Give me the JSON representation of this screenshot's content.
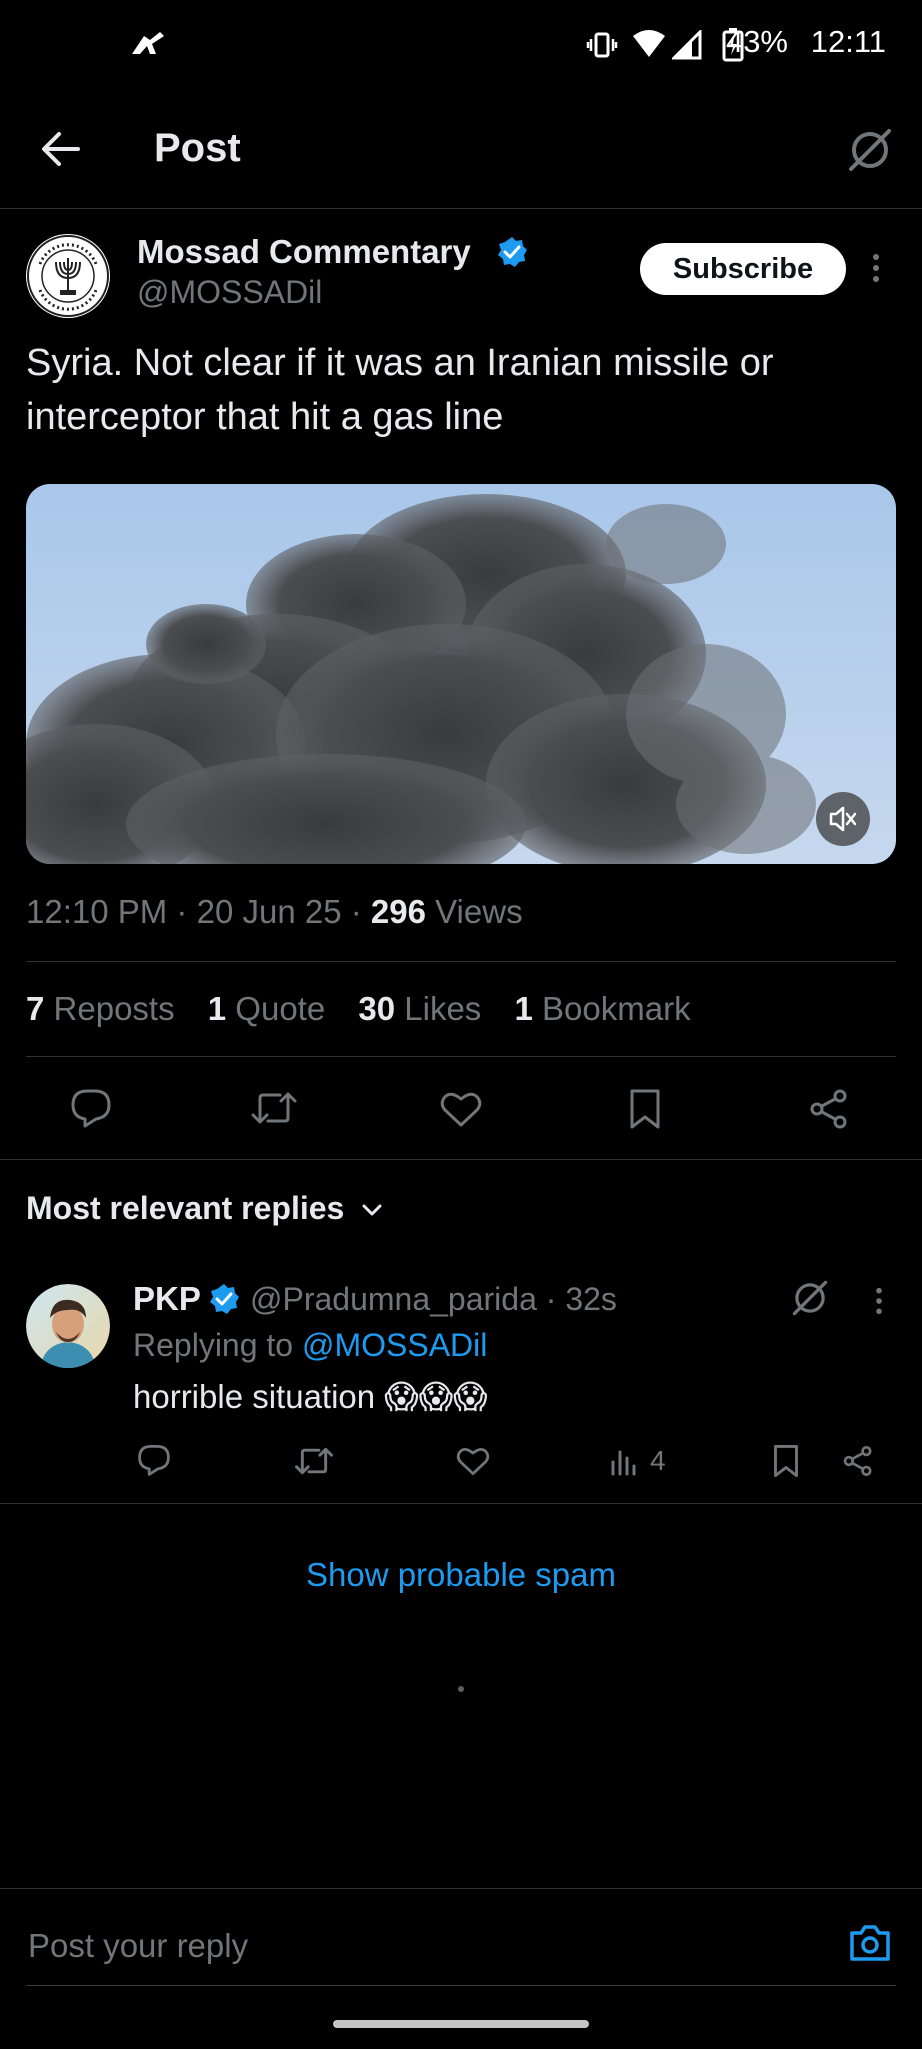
{
  "status_bar": {
    "time": "12:11",
    "battery": "43%"
  },
  "header": {
    "title": "Post"
  },
  "post": {
    "author_name": "Mossad Commentary",
    "handle": "@MOSSADil",
    "subscribe_label": "Subscribe",
    "text": "Syria. Not clear if it was an Iranian missile or interceptor that hit a gas line",
    "time": "12:10 PM",
    "date": "20 Jun 25",
    "views_count": "296",
    "views_label": "Views",
    "stats": {
      "reposts_count": "7",
      "reposts_label": "Reposts",
      "quote_count": "1",
      "quote_label": "Quote",
      "likes_count": "30",
      "likes_label": "Likes",
      "bookmark_count": "1",
      "bookmark_label": "Bookmark"
    }
  },
  "replies_section": {
    "sort_label": "Most relevant replies"
  },
  "reply": {
    "author_name": "PKP",
    "handle": "@Pradumna_parida",
    "time": "32s",
    "replying_to_label": "Replying to",
    "replying_to_handle": "@MOSSADil",
    "text": "horrible situation 😱😱😱",
    "views_count": "4"
  },
  "show_spam_label": "Show probable spam",
  "reply_box": {
    "placeholder": "Post your reply"
  },
  "colors": {
    "accent": "#1d9bf0",
    "background": "#000000",
    "text": "#e7e9ea",
    "muted": "#71767b"
  }
}
